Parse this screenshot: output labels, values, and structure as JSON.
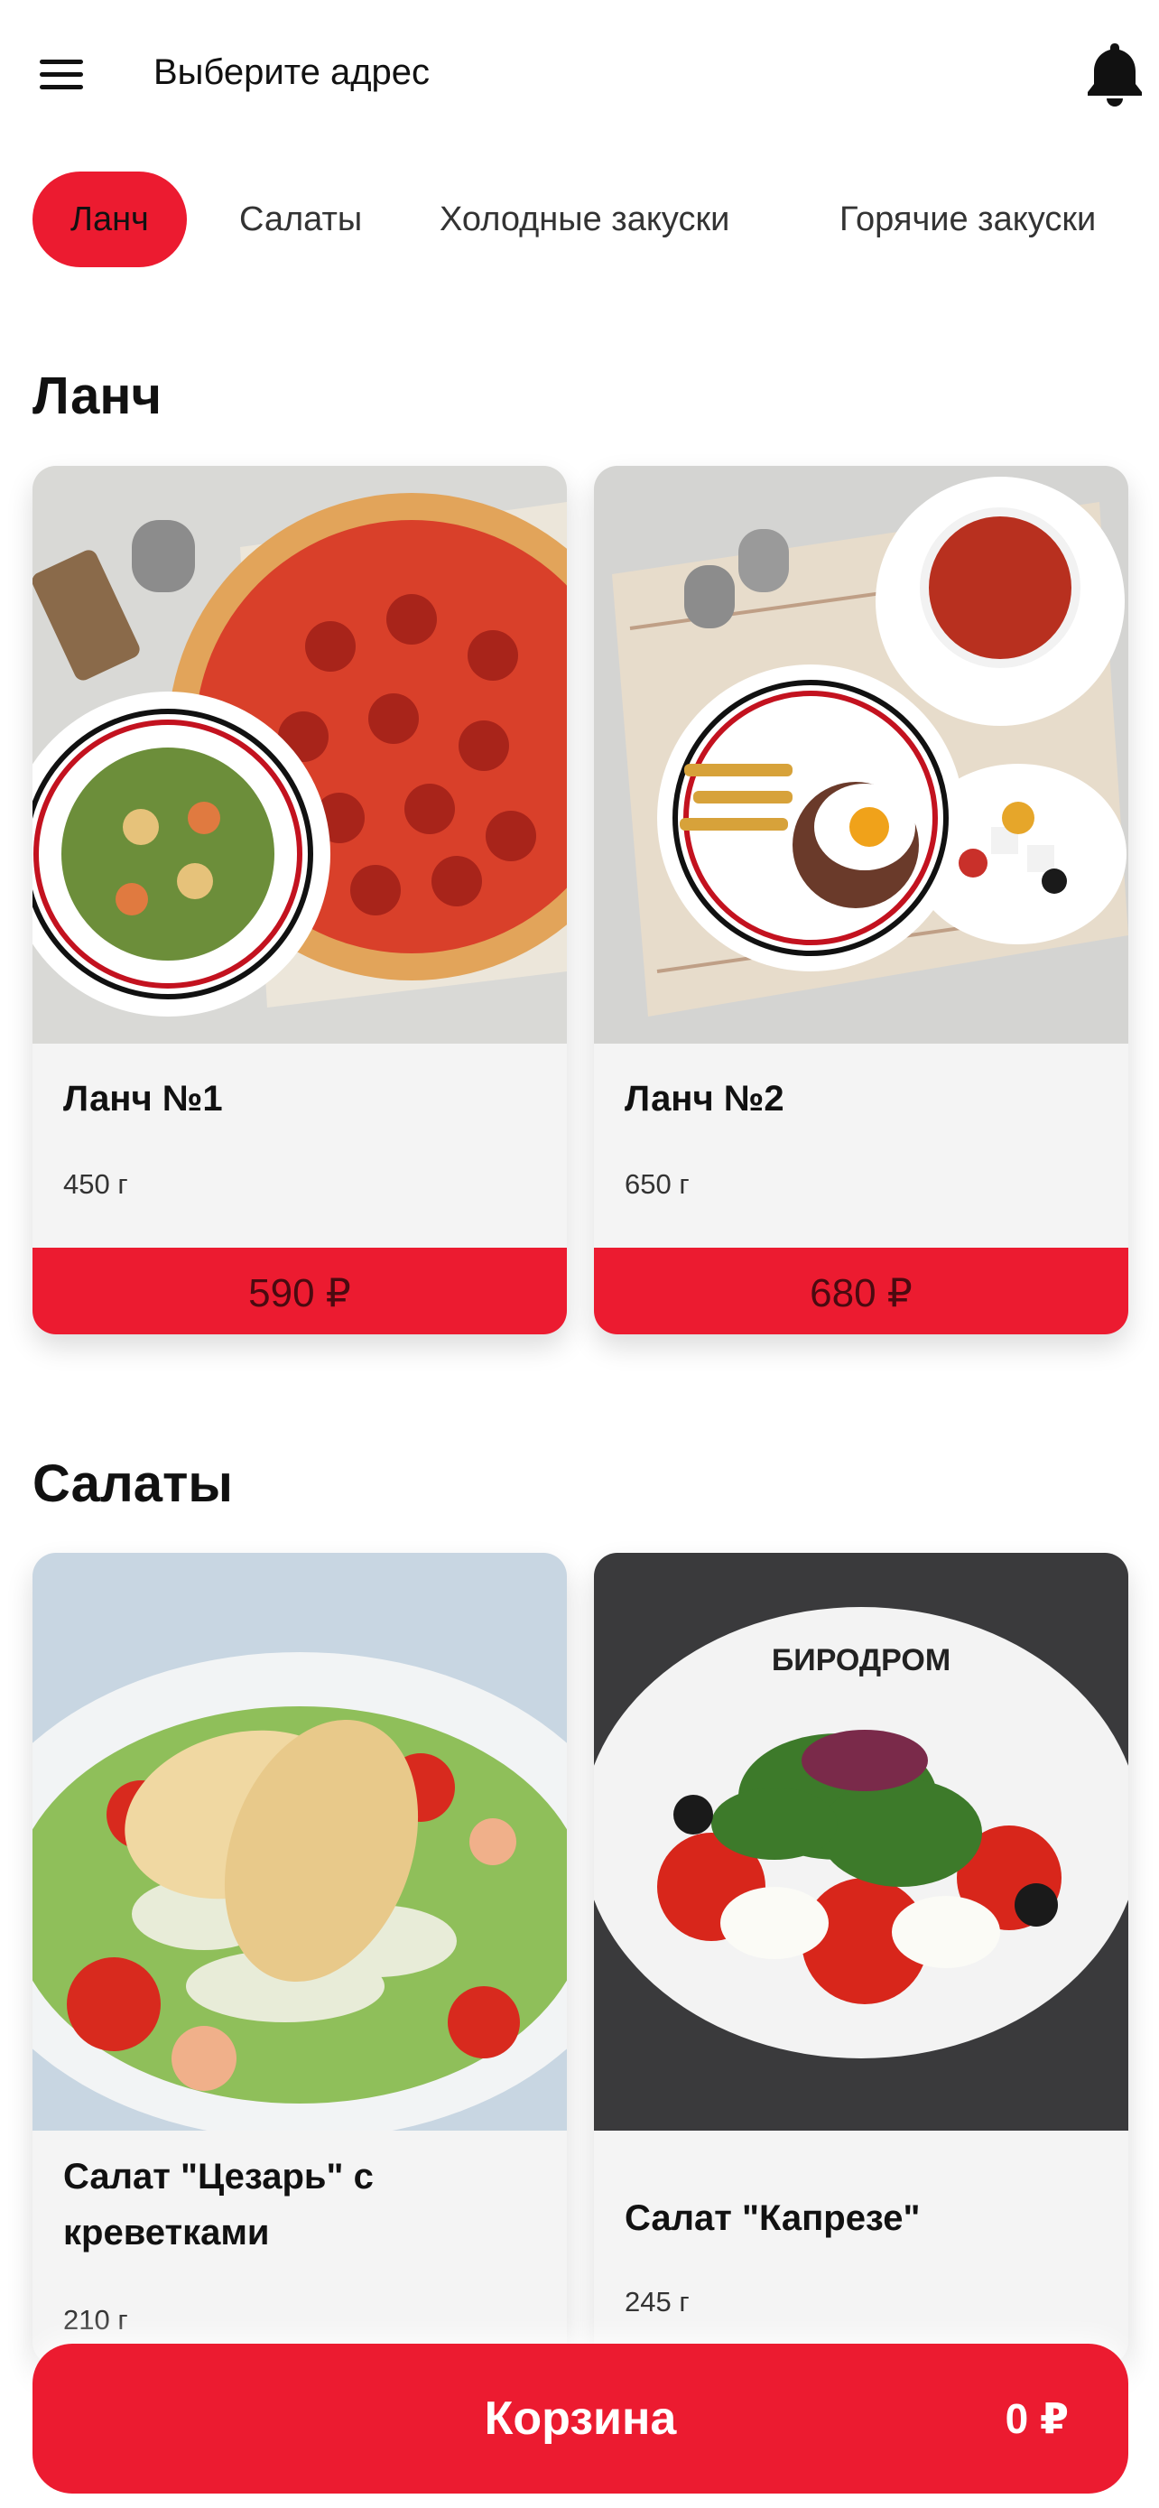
{
  "header": {
    "address_label": "Выберите адрес",
    "menu_icon": "hamburger-menu-icon",
    "bell_icon": "bell-icon"
  },
  "categories": [
    "Ланч",
    "Салаты",
    "Холодные закуски",
    "Горячие закуски"
  ],
  "active_category": "Ланч",
  "sections": [
    {
      "title": "Ланч",
      "items": [
        {
          "name": "Ланч №1",
          "weight": "450 г",
          "price": "590 ₽",
          "image": "pizza-and-caesar-salad-photo"
        },
        {
          "name": "Ланч №2",
          "weight": "650 г",
          "price": "680 ₽",
          "image": "steak-egg-soup-greek-salad-photo"
        }
      ]
    },
    {
      "title": "Салаты",
      "items": [
        {
          "name": "Салат \"Цезарь\" с креветками",
          "weight": "210 г",
          "image": "caesar-salad-photo"
        },
        {
          "name": "Салат \"Капрезе\"",
          "weight": "245 г",
          "image": "caprese-salad-photo"
        }
      ]
    }
  ],
  "cart": {
    "label": "Корзина",
    "total": "0 ₽"
  },
  "colors": {
    "accent": "#ec1b30",
    "card_background": "#f4f4f4"
  }
}
